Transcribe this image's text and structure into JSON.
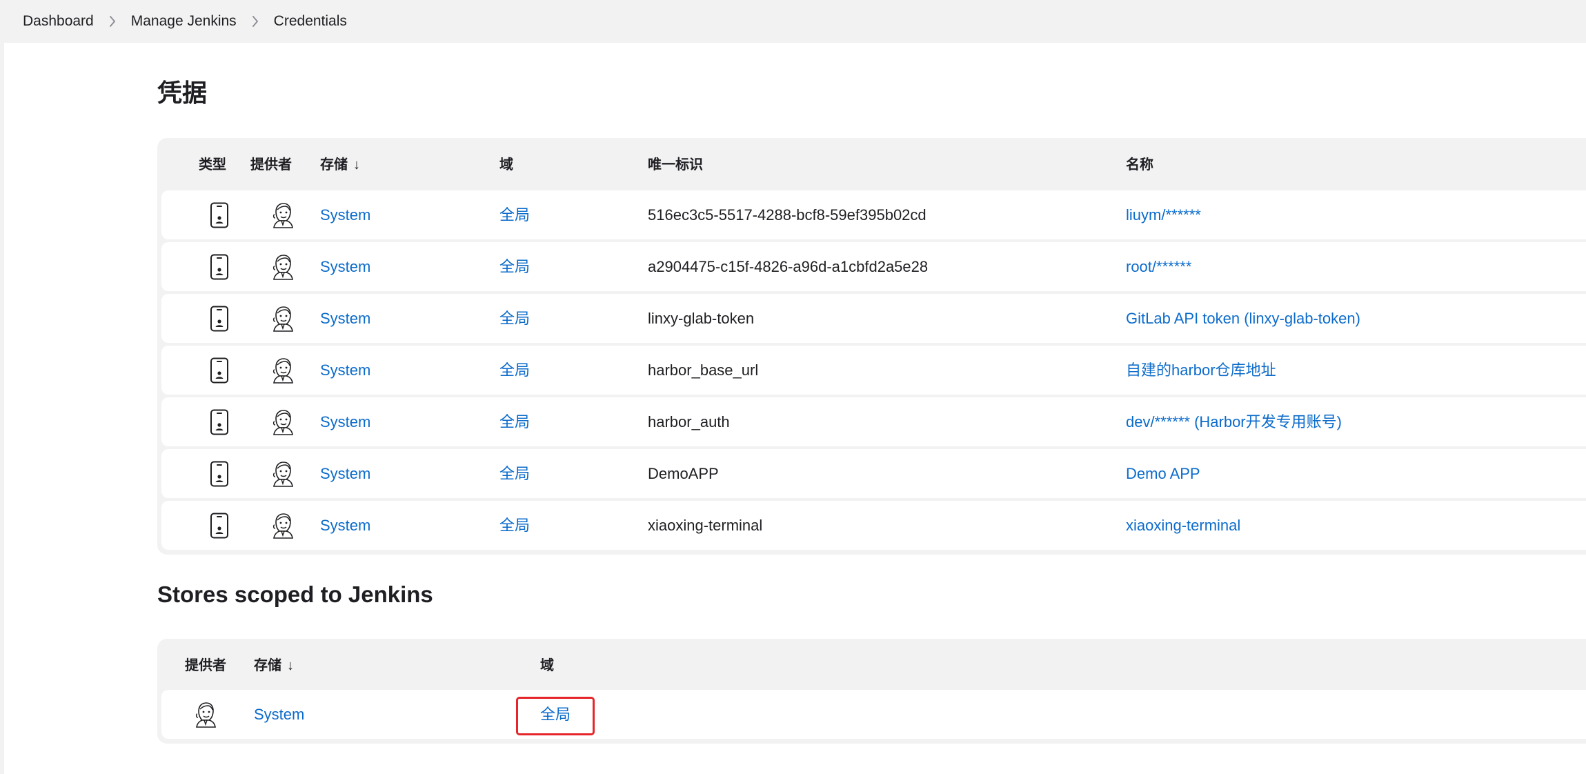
{
  "breadcrumb": {
    "items": [
      "Dashboard",
      "Manage Jenkins",
      "Credentials"
    ]
  },
  "page_title": "凭据",
  "credentials_table": {
    "headers": {
      "type": "类型",
      "provider": "提供者",
      "store": "存储",
      "store_sort_arrow": "↓",
      "domain": "域",
      "id": "唯一标识",
      "name": "名称"
    },
    "type_icon": "mobile-phone-icon",
    "provider_icon": "jenkins-butler-icon",
    "rows": [
      {
        "store": "System",
        "domain": "全局",
        "id": "516ec3c5-5517-4288-bcf8-59ef395b02cd",
        "name": "liuym/******"
      },
      {
        "store": "System",
        "domain": "全局",
        "id": "a2904475-c15f-4826-a96d-a1cbfd2a5e28",
        "name": "root/******"
      },
      {
        "store": "System",
        "domain": "全局",
        "id": "linxy-glab-token",
        "name": "GitLab API token (linxy-glab-token)"
      },
      {
        "store": "System",
        "domain": "全局",
        "id": "harbor_base_url",
        "name": "自建的harbor仓库地址"
      },
      {
        "store": "System",
        "domain": "全局",
        "id": "harbor_auth",
        "name": "dev/****** (Harbor开发专用账号)"
      },
      {
        "store": "System",
        "domain": "全局",
        "id": "DemoAPP",
        "name": "Demo APP"
      },
      {
        "store": "System",
        "domain": "全局",
        "id": "xiaoxing-terminal",
        "name": "xiaoxing-terminal"
      }
    ]
  },
  "stores_section": {
    "title": "Stores scoped to Jenkins",
    "headers": {
      "provider": "提供者",
      "store": "存储",
      "store_sort_arrow": "↓",
      "domain": "域"
    },
    "rows": [
      {
        "store": "System",
        "domain": "全局"
      }
    ],
    "highlight_color": "#e5252a"
  },
  "colors": {
    "link": "#0b6bcb",
    "card_background": "#f2f2f3",
    "breadcrumb_background": "#f2f2f3"
  }
}
